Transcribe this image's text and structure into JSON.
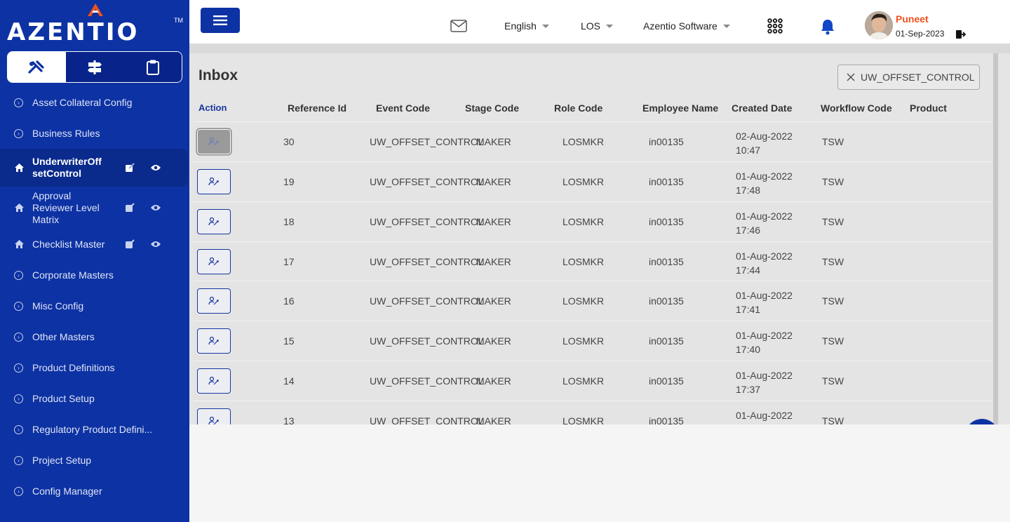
{
  "brand": {
    "name": "AZENTIO",
    "tm": "TM"
  },
  "topbar": {
    "language": "English",
    "module": "LOS",
    "company": "Azentio Software",
    "user_name": "Puneet",
    "user_date": "01-Sep-2023"
  },
  "sidebar": {
    "tabs": [
      {
        "icon": "tools-icon"
      },
      {
        "icon": "signpost-icon"
      },
      {
        "icon": "clipboard-icon"
      }
    ],
    "items": [
      {
        "label": "Asset Collateral Config",
        "type": "circle"
      },
      {
        "label": "Business Rules",
        "type": "circle"
      },
      {
        "label": "UnderwriterOffsetControl",
        "type": "home",
        "selected": true
      },
      {
        "label": "Approval Reviewer Level Matrix",
        "type": "home"
      },
      {
        "label": "Checklist Master",
        "type": "home"
      },
      {
        "label": "Corporate Masters",
        "type": "circle"
      },
      {
        "label": "Misc Config",
        "type": "circle"
      },
      {
        "label": "Other Masters",
        "type": "circle"
      },
      {
        "label": "Product Definitions",
        "type": "circle"
      },
      {
        "label": "Product Setup",
        "type": "circle"
      },
      {
        "label": "Regulatory Product Defini...",
        "type": "circle"
      },
      {
        "label": "Project Setup",
        "type": "circle"
      },
      {
        "label": "Config Manager",
        "type": "circle"
      }
    ]
  },
  "inbox": {
    "title": "Inbox",
    "filter": "UW_OFFSET_CONTROL",
    "columns": [
      "Action",
      "Reference Id",
      "Event Code",
      "Stage Code",
      "Role Code",
      "Employee Name",
      "Created Date",
      "Workflow Code",
      "Product"
    ],
    "rows": [
      {
        "ref": "30",
        "event": "UW_OFFSET_CONTROL",
        "stage": "MAKER",
        "role": "LOSMKR",
        "emp": "in00135",
        "date1": "02-Aug-2022",
        "date2": "10:47",
        "wf": "TSW",
        "product": ""
      },
      {
        "ref": "19",
        "event": "UW_OFFSET_CONTROL",
        "stage": "MAKER",
        "role": "LOSMKR",
        "emp": "in00135",
        "date1": "01-Aug-2022",
        "date2": "17:48",
        "wf": "TSW",
        "product": ""
      },
      {
        "ref": "18",
        "event": "UW_OFFSET_CONTROL",
        "stage": "MAKER",
        "role": "LOSMKR",
        "emp": "in00135",
        "date1": "01-Aug-2022",
        "date2": "17:46",
        "wf": "TSW",
        "product": ""
      },
      {
        "ref": "17",
        "event": "UW_OFFSET_CONTROL",
        "stage": "MAKER",
        "role": "LOSMKR",
        "emp": "in00135",
        "date1": "01-Aug-2022",
        "date2": "17:44",
        "wf": "TSW",
        "product": ""
      },
      {
        "ref": "16",
        "event": "UW_OFFSET_CONTROL",
        "stage": "MAKER",
        "role": "LOSMKR",
        "emp": "in00135",
        "date1": "01-Aug-2022",
        "date2": "17:41",
        "wf": "TSW",
        "product": ""
      },
      {
        "ref": "15",
        "event": "UW_OFFSET_CONTROL",
        "stage": "MAKER",
        "role": "LOSMKR",
        "emp": "in00135",
        "date1": "01-Aug-2022",
        "date2": "17:40",
        "wf": "TSW",
        "product": ""
      },
      {
        "ref": "14",
        "event": "UW_OFFSET_CONTROL",
        "stage": "MAKER",
        "role": "LOSMKR",
        "emp": "in00135",
        "date1": "01-Aug-2022",
        "date2": "17:37",
        "wf": "TSW",
        "product": ""
      },
      {
        "ref": "13",
        "event": "UW_OFFSET_CONTROL",
        "stage": "MAKER",
        "role": "LOSMKR",
        "emp": "in00135",
        "date1": "01-Aug-2022",
        "date2": "",
        "wf": "TSW",
        "product": ""
      }
    ]
  },
  "colors": {
    "sidebar": "#0d32a3",
    "accent": "#f0521e",
    "primary": "#17369e"
  }
}
